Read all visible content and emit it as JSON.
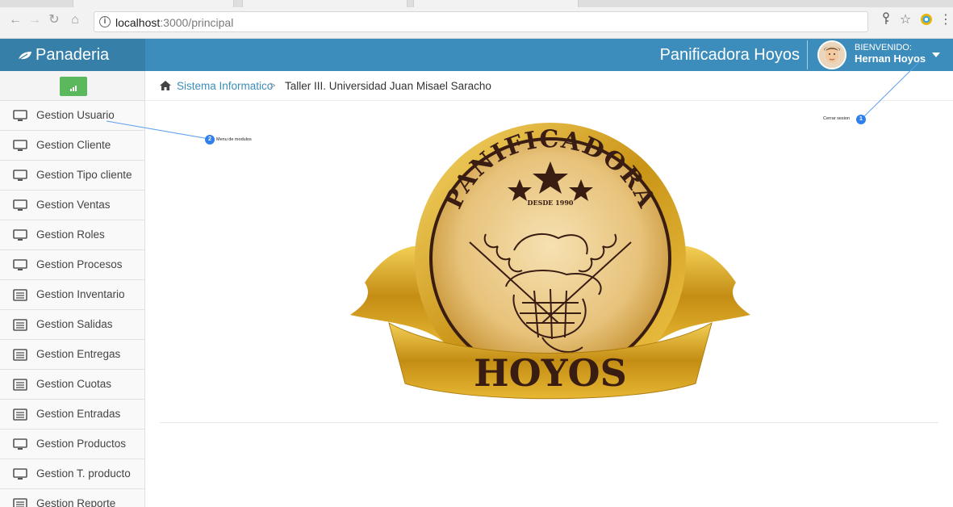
{
  "browser": {
    "url_host": "localhost",
    "url_rest": ":3000/principal"
  },
  "header": {
    "brand": "Panaderia",
    "title": "Panificadora Hoyos",
    "welcome_label": "BIENVENIDO:",
    "user_name": "Hernan Hoyos"
  },
  "sidebar": {
    "items": [
      {
        "label": "Gestion Usuario",
        "icon": "monitor-icon"
      },
      {
        "label": "Gestion Cliente",
        "icon": "monitor-icon"
      },
      {
        "label": "Gestion Tipo cliente",
        "icon": "monitor-icon"
      },
      {
        "label": "Gestion Ventas",
        "icon": "monitor-icon"
      },
      {
        "label": "Gestion Roles",
        "icon": "monitor-icon"
      },
      {
        "label": "Gestion Procesos",
        "icon": "monitor-icon"
      },
      {
        "label": "Gestion Inventario",
        "icon": "list-icon"
      },
      {
        "label": "Gestion Salidas",
        "icon": "list-icon"
      },
      {
        "label": "Gestion Entregas",
        "icon": "list-icon"
      },
      {
        "label": "Gestion Cuotas",
        "icon": "list-icon"
      },
      {
        "label": "Gestion Entradas",
        "icon": "list-icon"
      },
      {
        "label": "Gestion Productos",
        "icon": "monitor-icon"
      },
      {
        "label": "Gestion T. producto",
        "icon": "monitor-icon"
      },
      {
        "label": "Gestion Reporte",
        "icon": "list-icon"
      }
    ]
  },
  "breadcrumb": {
    "link": "Sistema Informatico",
    "separator": ">",
    "current": "Taller III. Universidad Juan Misael Saracho"
  },
  "logo": {
    "arc_text": "PANIFICADORA",
    "since": "DESDE 1990",
    "name": "HOYOS"
  },
  "annotations": [
    {
      "number": "1",
      "text": "Cerrar sesion"
    },
    {
      "number": "2",
      "text": "Menu de modulos"
    }
  ],
  "colors": {
    "header": "#3c8dbc",
    "brand": "#367fa9",
    "annotation": "#2f80ed",
    "gold": "#d9a928"
  }
}
